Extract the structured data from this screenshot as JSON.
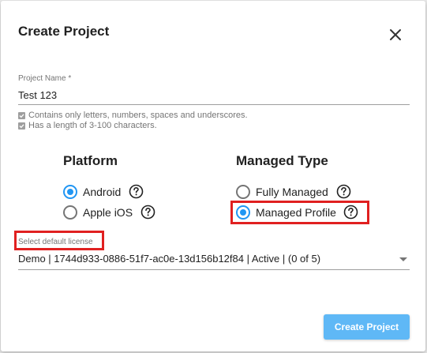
{
  "dialog": {
    "title": "Create Project",
    "close_icon": "close-icon"
  },
  "project_name": {
    "label": "Project Name *",
    "value": "Test 123",
    "rules": [
      "Contains only letters, numbers, spaces and underscores.",
      "Has a length of 3-100 characters."
    ]
  },
  "platform": {
    "heading": "Platform",
    "options": [
      {
        "label": "Android",
        "selected": true
      },
      {
        "label": "Apple iOS",
        "selected": false
      }
    ]
  },
  "managed_type": {
    "heading": "Managed Type",
    "options": [
      {
        "label": "Fully Managed",
        "selected": false
      },
      {
        "label": "Managed Profile",
        "selected": true
      }
    ]
  },
  "license": {
    "label": "Select default license",
    "value": "Demo | 1744d933-0886-51f7-ac0e-13d156b12f84 | Active | (0 of 5)"
  },
  "actions": {
    "create_label": "Create Project"
  },
  "colors": {
    "accent": "#2196f3",
    "button": "#5fb8f6",
    "highlight": "#e02020"
  }
}
